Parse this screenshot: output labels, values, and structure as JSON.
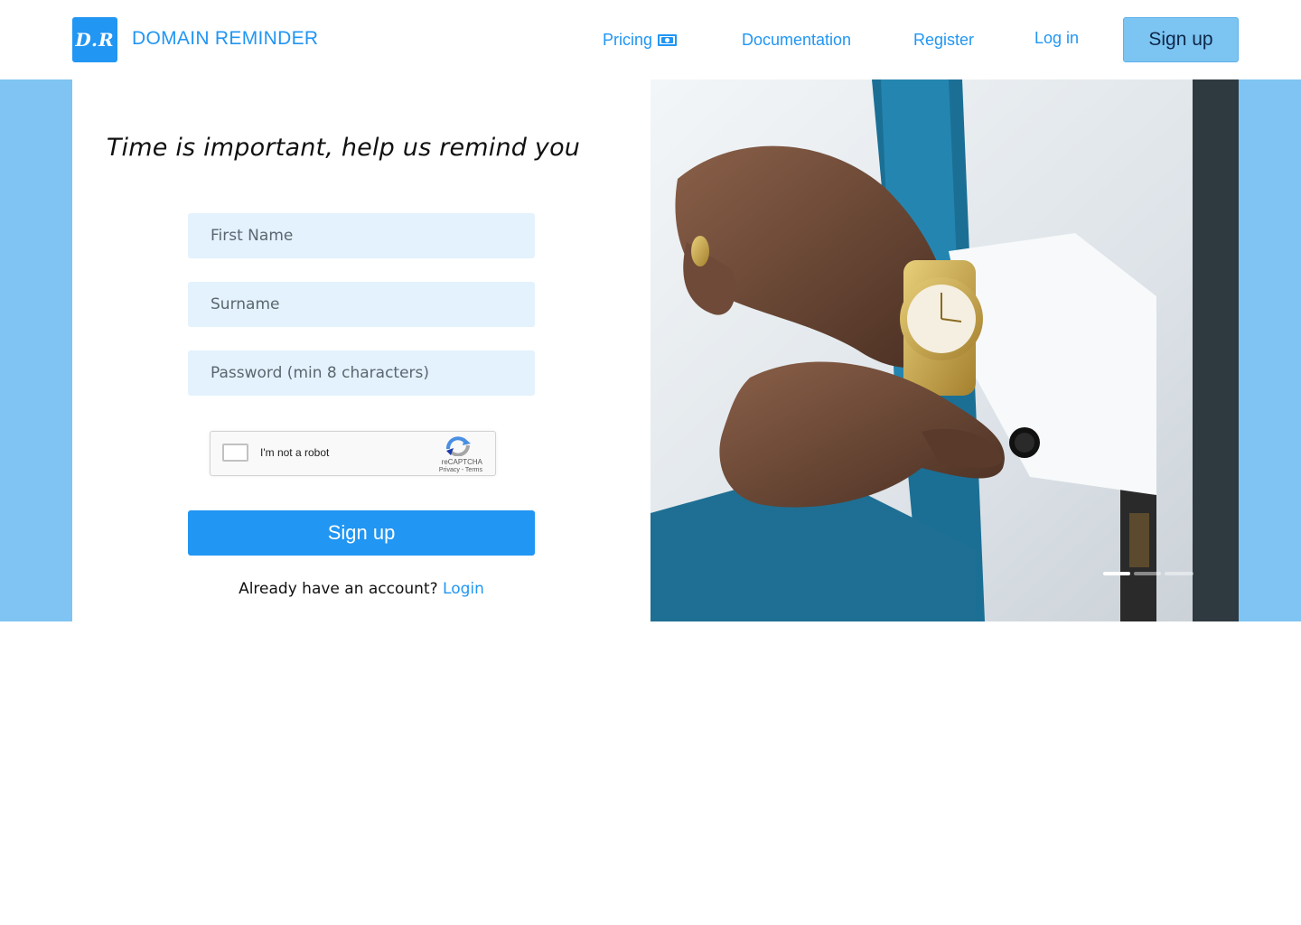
{
  "header": {
    "logo_text": "D.R",
    "brand": "DOMAIN REMINDER",
    "nav": {
      "pricing": "Pricing",
      "pricing_icon": "money-bill-icon",
      "documentation": "Documentation",
      "register": "Register",
      "login": "Log in"
    },
    "signup_label": "Sign up"
  },
  "hero": {
    "tagline": "Time is important, help us remind you"
  },
  "form": {
    "first_name_placeholder": "First Name",
    "surname_placeholder": "Surname",
    "password_placeholder": "Password (min 8 characters)",
    "captcha": {
      "label": "I'm not a robot",
      "brand": "reCAPTCHA",
      "terms": "Privacy - Terms"
    },
    "submit_label": "Sign up",
    "account_prompt": "Already have an account?",
    "login_link": "Login"
  },
  "carousel": {
    "slides": 3,
    "active_index": 0
  },
  "colors": {
    "primary": "#2196f3",
    "band": "#7fc4f2",
    "field_bg": "#e3f2fc",
    "signup_top_bg": "#7cc4f2"
  }
}
